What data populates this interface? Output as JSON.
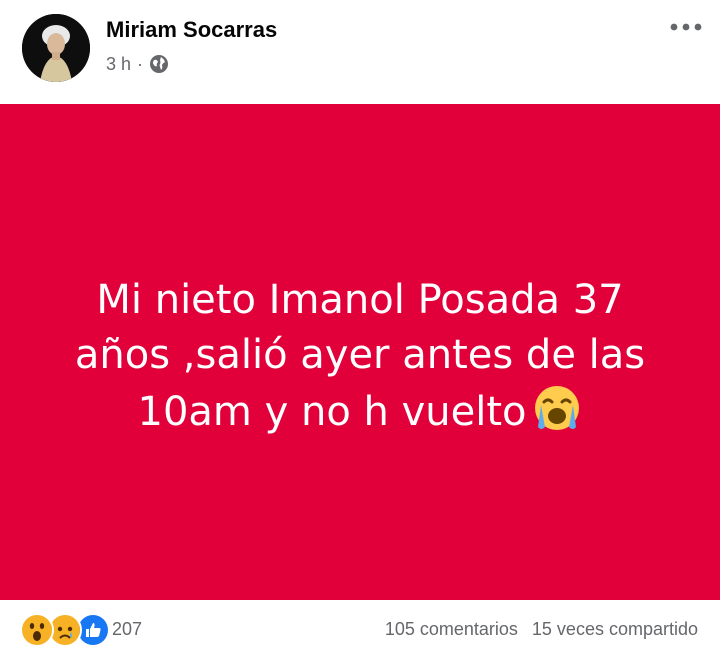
{
  "post": {
    "author": "Miriam Socarras",
    "time": "3 h",
    "separator": "·",
    "privacy_icon": "globe-icon",
    "more_icon": "more-options-icon",
    "text": "Mi nieto Imanol Posada 37\naños ,salió ayer antes de las\n10am y  no h vuelto",
    "text_emoji": "crying-face-emoji",
    "background_color": "#e1003a"
  },
  "footer": {
    "reactions": [
      "wow-reaction-icon",
      "sad-reaction-icon",
      "like-reaction-icon"
    ],
    "reaction_count": "207",
    "comments": "105 comentarios",
    "shares": "15 veces compartido"
  }
}
